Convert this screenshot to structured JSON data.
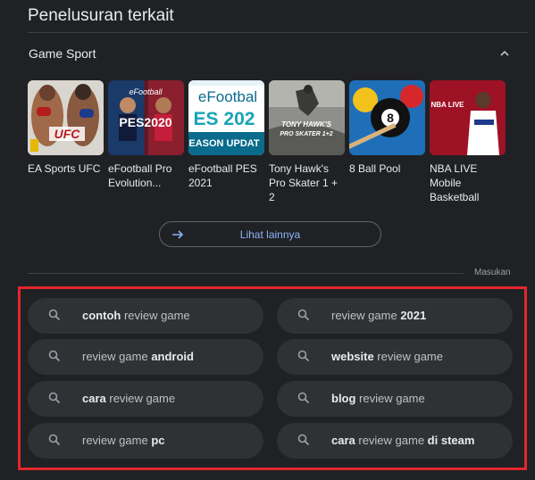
{
  "heading": "Penelusuran terkait",
  "group": {
    "title": "Game Sport",
    "items": [
      {
        "name": "EA Sports UFC"
      },
      {
        "name": "eFootball Pro Evolution..."
      },
      {
        "name": "eFootball PES 2021"
      },
      {
        "name": "Tony Hawk's Pro Skater 1 + 2"
      },
      {
        "name": "8 Ball Pool"
      },
      {
        "name": "NBA LIVE Mobile Basketball"
      }
    ],
    "thumb_text": {
      "ufc": "UFC",
      "pes_top": "eFootball",
      "pes": "PES2020",
      "pes21_a": "eFootbal",
      "pes21_b": "ES 202",
      "pes21_c": "EASON UPDAT",
      "tony_a": "TONY HAWK'S",
      "tony_b": "PRO SKATER 1+2",
      "ball": "8",
      "nba": "NBA LIVE"
    }
  },
  "more_label": "Lihat lainnya",
  "feedback": "Masukan",
  "suggestions": [
    {
      "bold_pre": "contoh",
      "normal": " review game",
      "bold_post": ""
    },
    {
      "bold_pre": "",
      "normal": "review game ",
      "bold_post": "2021"
    },
    {
      "bold_pre": "",
      "normal": "review game ",
      "bold_post": "android"
    },
    {
      "bold_pre": "website",
      "normal": " review game",
      "bold_post": ""
    },
    {
      "bold_pre": "cara",
      "normal": " review game",
      "bold_post": ""
    },
    {
      "bold_pre": "blog",
      "normal": " review game",
      "bold_post": ""
    },
    {
      "bold_pre": "",
      "normal": "review game ",
      "bold_post": "pc"
    },
    {
      "bold_pre": "cara",
      "normal": " review game ",
      "bold_post": "di steam"
    }
  ],
  "colors": {
    "background": "#202124",
    "chip": "#303134",
    "link": "#8ab4f8",
    "highlight": "#e3262d"
  }
}
